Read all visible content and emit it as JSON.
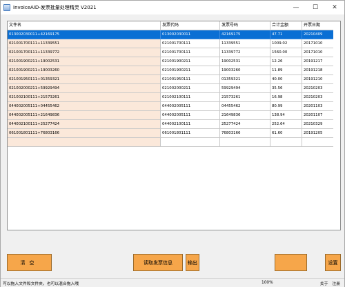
{
  "window": {
    "title": "InvoiceAID-发票批量处理精灵 V2021",
    "minimize_glyph": "—",
    "maximize_glyph": "☐",
    "close_glyph": "✕"
  },
  "table": {
    "columns": [
      "文件名",
      "发票代码",
      "发票号码",
      "合计金额",
      "开票日期"
    ],
    "rows": [
      [
        "013002030011+42169175",
        "013002030011",
        "42169175",
        "47.71",
        "20210409"
      ],
      [
        "021001700111+11339551",
        "021001700111",
        "11339551",
        "1009.02",
        "20171010"
      ],
      [
        "021001700111+11339772",
        "021001700111",
        "11339772",
        "1560.00",
        "20171010"
      ],
      [
        "021001900211+19002531",
        "021001900211",
        "19002531",
        "12.26",
        "20191217"
      ],
      [
        "021001900211+19003260",
        "021001900211",
        "19003260",
        "11.89",
        "20191218"
      ],
      [
        "021001950111+01359321",
        "021001950111",
        "01359321",
        "40.00",
        "20191210"
      ],
      [
        "021002000211+59929494",
        "021002000211",
        "59929494",
        "35.56",
        "20210203"
      ],
      [
        "021002100111+21573261",
        "021002100111",
        "21573261",
        "16.98",
        "20210203"
      ],
      [
        "044002005111+04455462",
        "044002005111",
        "04455462",
        "80.99",
        "20201103"
      ],
      [
        "044002005111+21649836",
        "044002005111",
        "21649836",
        "138.94",
        "20201107"
      ],
      [
        "044002100111+25277424",
        "044002100111",
        "25277424",
        "252.64",
        "20210329"
      ],
      [
        "061001801111+76803166",
        "061001801111",
        "76803166",
        "61.60",
        "20191205"
      ]
    ],
    "selected_row": 0
  },
  "buttons": {
    "clear": "清空",
    "read_invoice": "读取发票信息",
    "export": "输出",
    "right1": "",
    "right2": "设置"
  },
  "status": {
    "message": "可以拖入文件和文件夹，也可以混合拖入哦",
    "zoom": "100%",
    "about": "关于",
    "register": "注册"
  }
}
